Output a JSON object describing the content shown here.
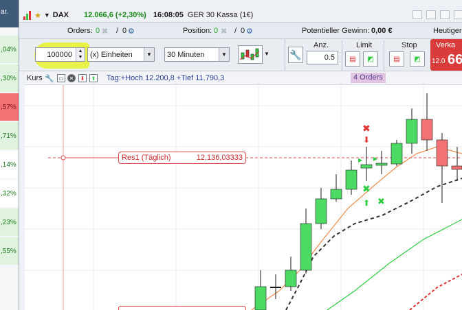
{
  "sidebar": {
    "header": "ar.",
    "rows": [
      {
        "value": ",04%",
        "kind": "pos"
      },
      {
        "value": ",30%",
        "kind": "pos"
      },
      {
        "value": ",57%",
        "kind": "neg"
      },
      {
        "value": ",71%",
        "kind": "pos"
      },
      {
        "value": ",14%",
        "kind": "neu"
      },
      {
        "value": ",32%",
        "kind": "neu"
      },
      {
        "value": ",23%",
        "kind": "pos"
      },
      {
        "value": ",55%",
        "kind": "pos"
      }
    ]
  },
  "titlebar": {
    "symbol": "DAX",
    "price": "12.066,6 (+2,30%)",
    "time": "16:08:05",
    "name": "GER 30 Kassa (1€)"
  },
  "inforow": {
    "orders_label": "Orders:",
    "orders_value": "0",
    "orders_sep": "/",
    "orders_value2": "0",
    "position_label": "Position:",
    "position_value": "0",
    "position_sep": "/",
    "position_value2": "0",
    "gain_label": "Potentieller Gewinn:",
    "gain_value": "0,00 €",
    "right_text": "Heutiger"
  },
  "toolbar": {
    "quantity": "100000",
    "unit": "(x) Einheiten",
    "interval": "30 Minuten",
    "anz_label": "Anz.",
    "anz_value": "0.5",
    "limit_label": "Limit",
    "stop_label": "Stop",
    "sell_label": "Verka",
    "sell_price_small": "12.0",
    "sell_price_big": "66",
    "highlight_color": "#e9f23c"
  },
  "chart_header": {
    "kurs_label": "Kurs",
    "tag_text": "Tag:+Hoch 12.200,8 +Tief 11.790,3",
    "orders_badge": "4 Orders"
  },
  "resistance": {
    "name": "Res1 (Täglich)",
    "value": "12.136,03333",
    "color": "#d94a4a"
  },
  "colors": {
    "up": "#4cd964",
    "down": "#f07272",
    "ema_fast": "#f08a4b",
    "ema_dashed": "#333333",
    "green_line": "#2ecc40",
    "red_dashed": "#e03030"
  }
}
